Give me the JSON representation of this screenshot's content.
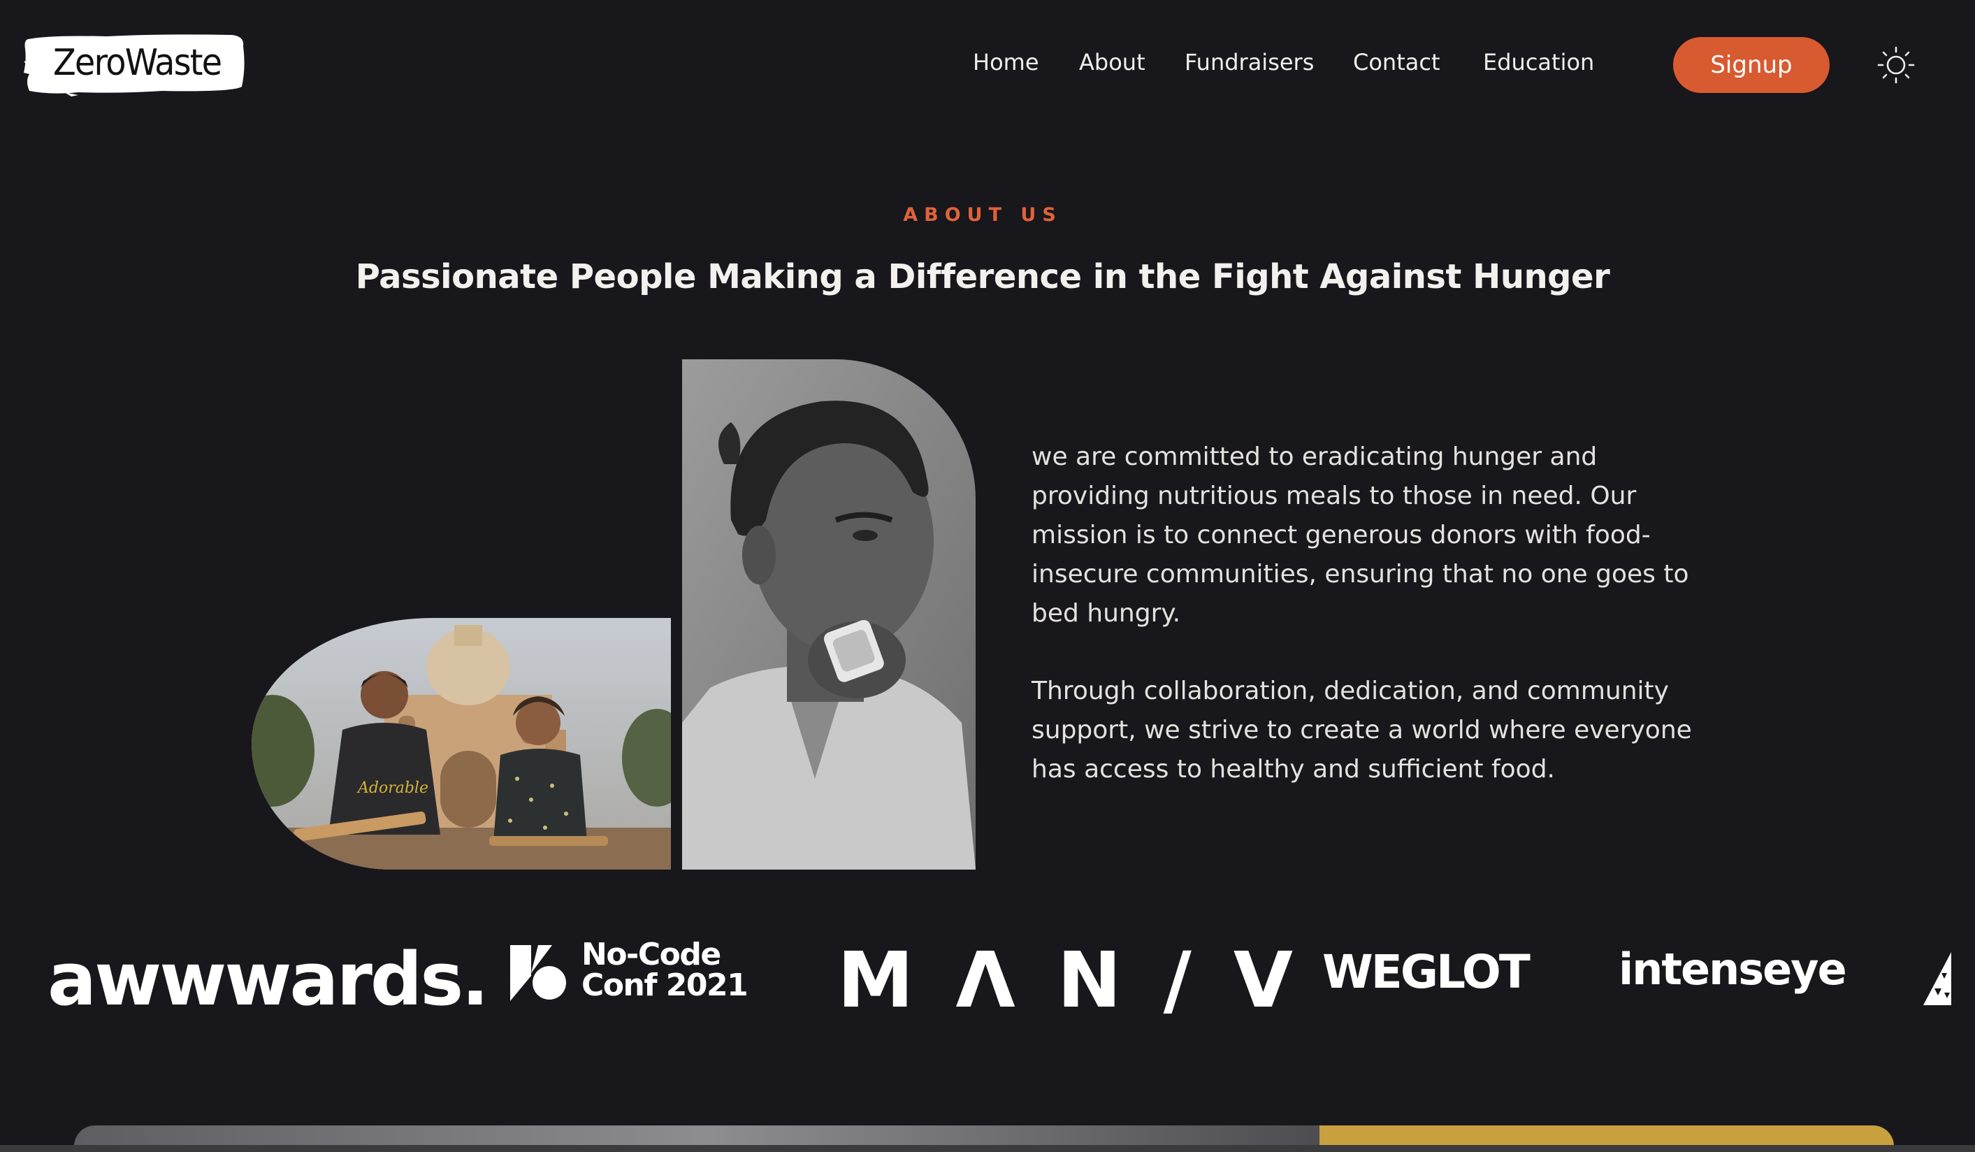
{
  "brand": {
    "logo_text": "ZeroWaste"
  },
  "nav": {
    "links": [
      "Home",
      "About",
      "Fundraisers",
      "Contact",
      "Education"
    ],
    "signup_label": "Signup",
    "theme_toggle_icon": "sun-icon"
  },
  "about": {
    "eyebrow": "ABOUT US",
    "headline": "Passionate People Making a Difference in the Fight Against Hunger",
    "paragraphs": [
      "we are committed to eradicating hunger and providing nutritious meals to those in need. Our mission is to connect generous donors with food-insecure communities, ensuring that no one goes to bed hungry.",
      "Through collaboration, dedication, and community support, we strive to create a world where everyone has access to healthy and sufficient food."
    ]
  },
  "partners": {
    "awwwards": "awwwards.",
    "nocode_line1": "No-Code",
    "nocode_line2": "Conf 2021",
    "manv": "MΛN/V",
    "weglot": "WEGLOT",
    "intenseye": "intenseye"
  },
  "colors": {
    "background": "#18171b",
    "accent": "#d85a30",
    "eyebrow": "#e0623a",
    "gold": "#c9a040"
  }
}
